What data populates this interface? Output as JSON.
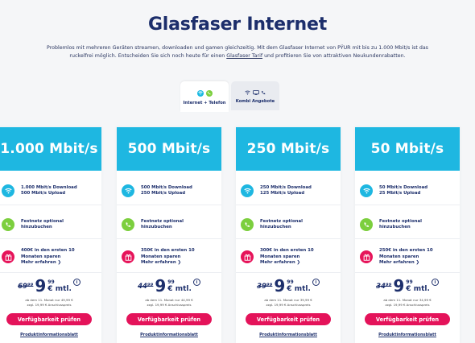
{
  "title": "Glasfaser Internet",
  "intro": {
    "line1": "Problemlos mit mehreren Geräten streamen, downloaden und gamen gleichzeitig. Mit dem Glasfaser Internet von PŸUR mit bis zu 1.000 Mbit/s ist das",
    "line2_pre": "ruckelfrei möglich. Entscheiden Sie sich noch heute für einen ",
    "link": "Glasfaser Tarif",
    "line2_post": " und profitieren Sie von attraktiven Neukundenrabatten."
  },
  "tabs": [
    {
      "label": "Internet + Telefon",
      "active": true
    },
    {
      "label": "Kombi Angebote",
      "active": false
    }
  ],
  "cards": [
    {
      "speed": "1.000 Mbit/s",
      "download": "1.000 Mbit/s Download",
      "upload": "500 Mbit/s Upload",
      "phone1": "Festnetz optional",
      "phone2": "hinzubuchen",
      "promo1": "400€ in den ersten 10",
      "promo2": "Monaten sparen",
      "more": "Mehr erfahren ❯",
      "old_price": "69⁹⁹",
      "price": "9",
      "cents": "99",
      "unit": "€ mtl.",
      "fine1": "ab dem 11. Monat nur 49,99 €",
      "fine2": "zzgl. 19,99 € Anschlusspreis",
      "cta": "Verfügbarkeit prüfen",
      "pib": "Produktinformationsblatt"
    },
    {
      "speed": "500 Mbit/s",
      "download": "500 Mbit/s Download",
      "upload": "250 Mbit/s Upload",
      "phone1": "Festnetz optional",
      "phone2": "hinzubuchen",
      "promo1": "350€ in den ersten 10",
      "promo2": "Monaten sparen",
      "more": "Mehr erfahren ❯",
      "old_price": "44⁹⁹",
      "price": "9",
      "cents": "99",
      "unit": "€ mtl.",
      "fine1": "ab dem 11. Monat nur 44,99 €",
      "fine2": "zzgl. 19,99 € Anschlusspreis",
      "cta": "Verfügbarkeit prüfen",
      "pib": "Produktinformationsblatt"
    },
    {
      "speed": "250 Mbit/s",
      "download": "250 Mbit/s Download",
      "upload": "125 Mbit/s Upload",
      "phone1": "Festnetz optional",
      "phone2": "hinzubuchen",
      "promo1": "300€ in den ersten 10",
      "promo2": "Monaten sparen",
      "more": "Mehr erfahren ❯",
      "old_price": "39⁹⁹",
      "price": "9",
      "cents": "99",
      "unit": "€ mtl.",
      "fine1": "ab dem 11. Monat nur 39,99 €",
      "fine2": "zzgl. 19,99 € Anschlusspreis",
      "cta": "Verfügbarkeit prüfen",
      "pib": "Produktinformationsblatt"
    },
    {
      "speed": "50 Mbit/s",
      "download": "50 Mbit/s Download",
      "upload": "25 Mbit/s Upload",
      "phone1": "Festnetz optional",
      "phone2": "hinzubuchen",
      "promo1": "250€ in den ersten 10",
      "promo2": "Monaten sparen",
      "more": "Mehr erfahren ❯",
      "old_price": "34⁹⁹",
      "price": "9",
      "cents": "99",
      "unit": "€ mtl.",
      "fine1": "ab dem 11. Monat nur 34,99 €",
      "fine2": "zzgl. 19,99 € Anschlusspreis",
      "cta": "Verfügbarkeit prüfen",
      "pib": "Produktinformationsblatt"
    }
  ],
  "icons": {
    "speed": "wifi-icon",
    "phone": "phone-icon",
    "promo": "gift-icon",
    "info": "info-icon"
  },
  "colors": {
    "brand_cyan": "#1eb7e1",
    "cta_pink": "#e4135a",
    "phone_green": "#7ccf3e",
    "text_navy": "#1c2e6b"
  }
}
